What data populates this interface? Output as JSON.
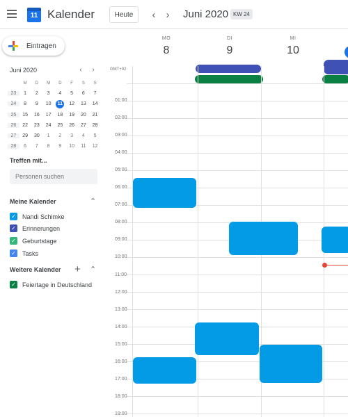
{
  "header": {
    "app_title": "Kalender",
    "logo_day": "11",
    "today_label": "Heute",
    "prev_icon": "chevron-left",
    "next_icon": "chevron-right",
    "month_title": "Juni 2020",
    "week_badge": "KW 24"
  },
  "sidebar": {
    "create_label": "Eintragen",
    "mini_calendar": {
      "title": "Juni 2020",
      "weekdays": [
        "M",
        "D",
        "M",
        "D",
        "F",
        "S",
        "S"
      ],
      "weeks": [
        {
          "kw": "23",
          "days": [
            "1",
            "2",
            "3",
            "4",
            "5",
            "6",
            "7"
          ]
        },
        {
          "kw": "24",
          "days": [
            "8",
            "9",
            "10",
            "11",
            "12",
            "13",
            "14"
          ]
        },
        {
          "kw": "25",
          "days": [
            "15",
            "16",
            "17",
            "18",
            "19",
            "20",
            "21"
          ]
        },
        {
          "kw": "26",
          "days": [
            "22",
            "23",
            "24",
            "25",
            "26",
            "27",
            "28"
          ]
        },
        {
          "kw": "27",
          "days": [
            "29",
            "30",
            "1",
            "2",
            "3",
            "4",
            "5"
          ]
        },
        {
          "kw": "28",
          "days": [
            "6",
            "7",
            "8",
            "9",
            "10",
            "11",
            "12"
          ]
        }
      ],
      "today": "11"
    },
    "meet_title": "Treffen mit...",
    "search_placeholder": "Personen suchen",
    "my_calendars_title": "Meine Kalender",
    "my_calendars": [
      {
        "label": "Nandi Schimke",
        "color": "#039be5"
      },
      {
        "label": "Erinnerungen",
        "color": "#3f51b5"
      },
      {
        "label": "Geburtstage",
        "color": "#33b679"
      },
      {
        "label": "Tasks",
        "color": "#4285f4"
      }
    ],
    "other_calendars_title": "Weitere Kalender",
    "other_calendars": [
      {
        "label": "Feiertage in Deutschland",
        "color": "#0b8043"
      }
    ]
  },
  "week": {
    "timezone": "GMT+02",
    "days": [
      {
        "name": "MO",
        "num": "8"
      },
      {
        "name": "DI",
        "num": "9"
      },
      {
        "name": "MI",
        "num": "10"
      }
    ],
    "hours": [
      "01:00",
      "02:00",
      "03:00",
      "04:00",
      "05:00",
      "06:00",
      "07:00",
      "08:00",
      "09:00",
      "10:00",
      "11:00",
      "12:00",
      "13:00",
      "14:00",
      "15:00",
      "16:00",
      "17:00",
      "18:00",
      "19:00"
    ]
  },
  "colors": {
    "event_blue": "#039be5",
    "allday_indigo": "#3f51b5",
    "allday_green": "#0b8043",
    "now_red": "#ea4335",
    "today_blue": "#1a73e8"
  }
}
